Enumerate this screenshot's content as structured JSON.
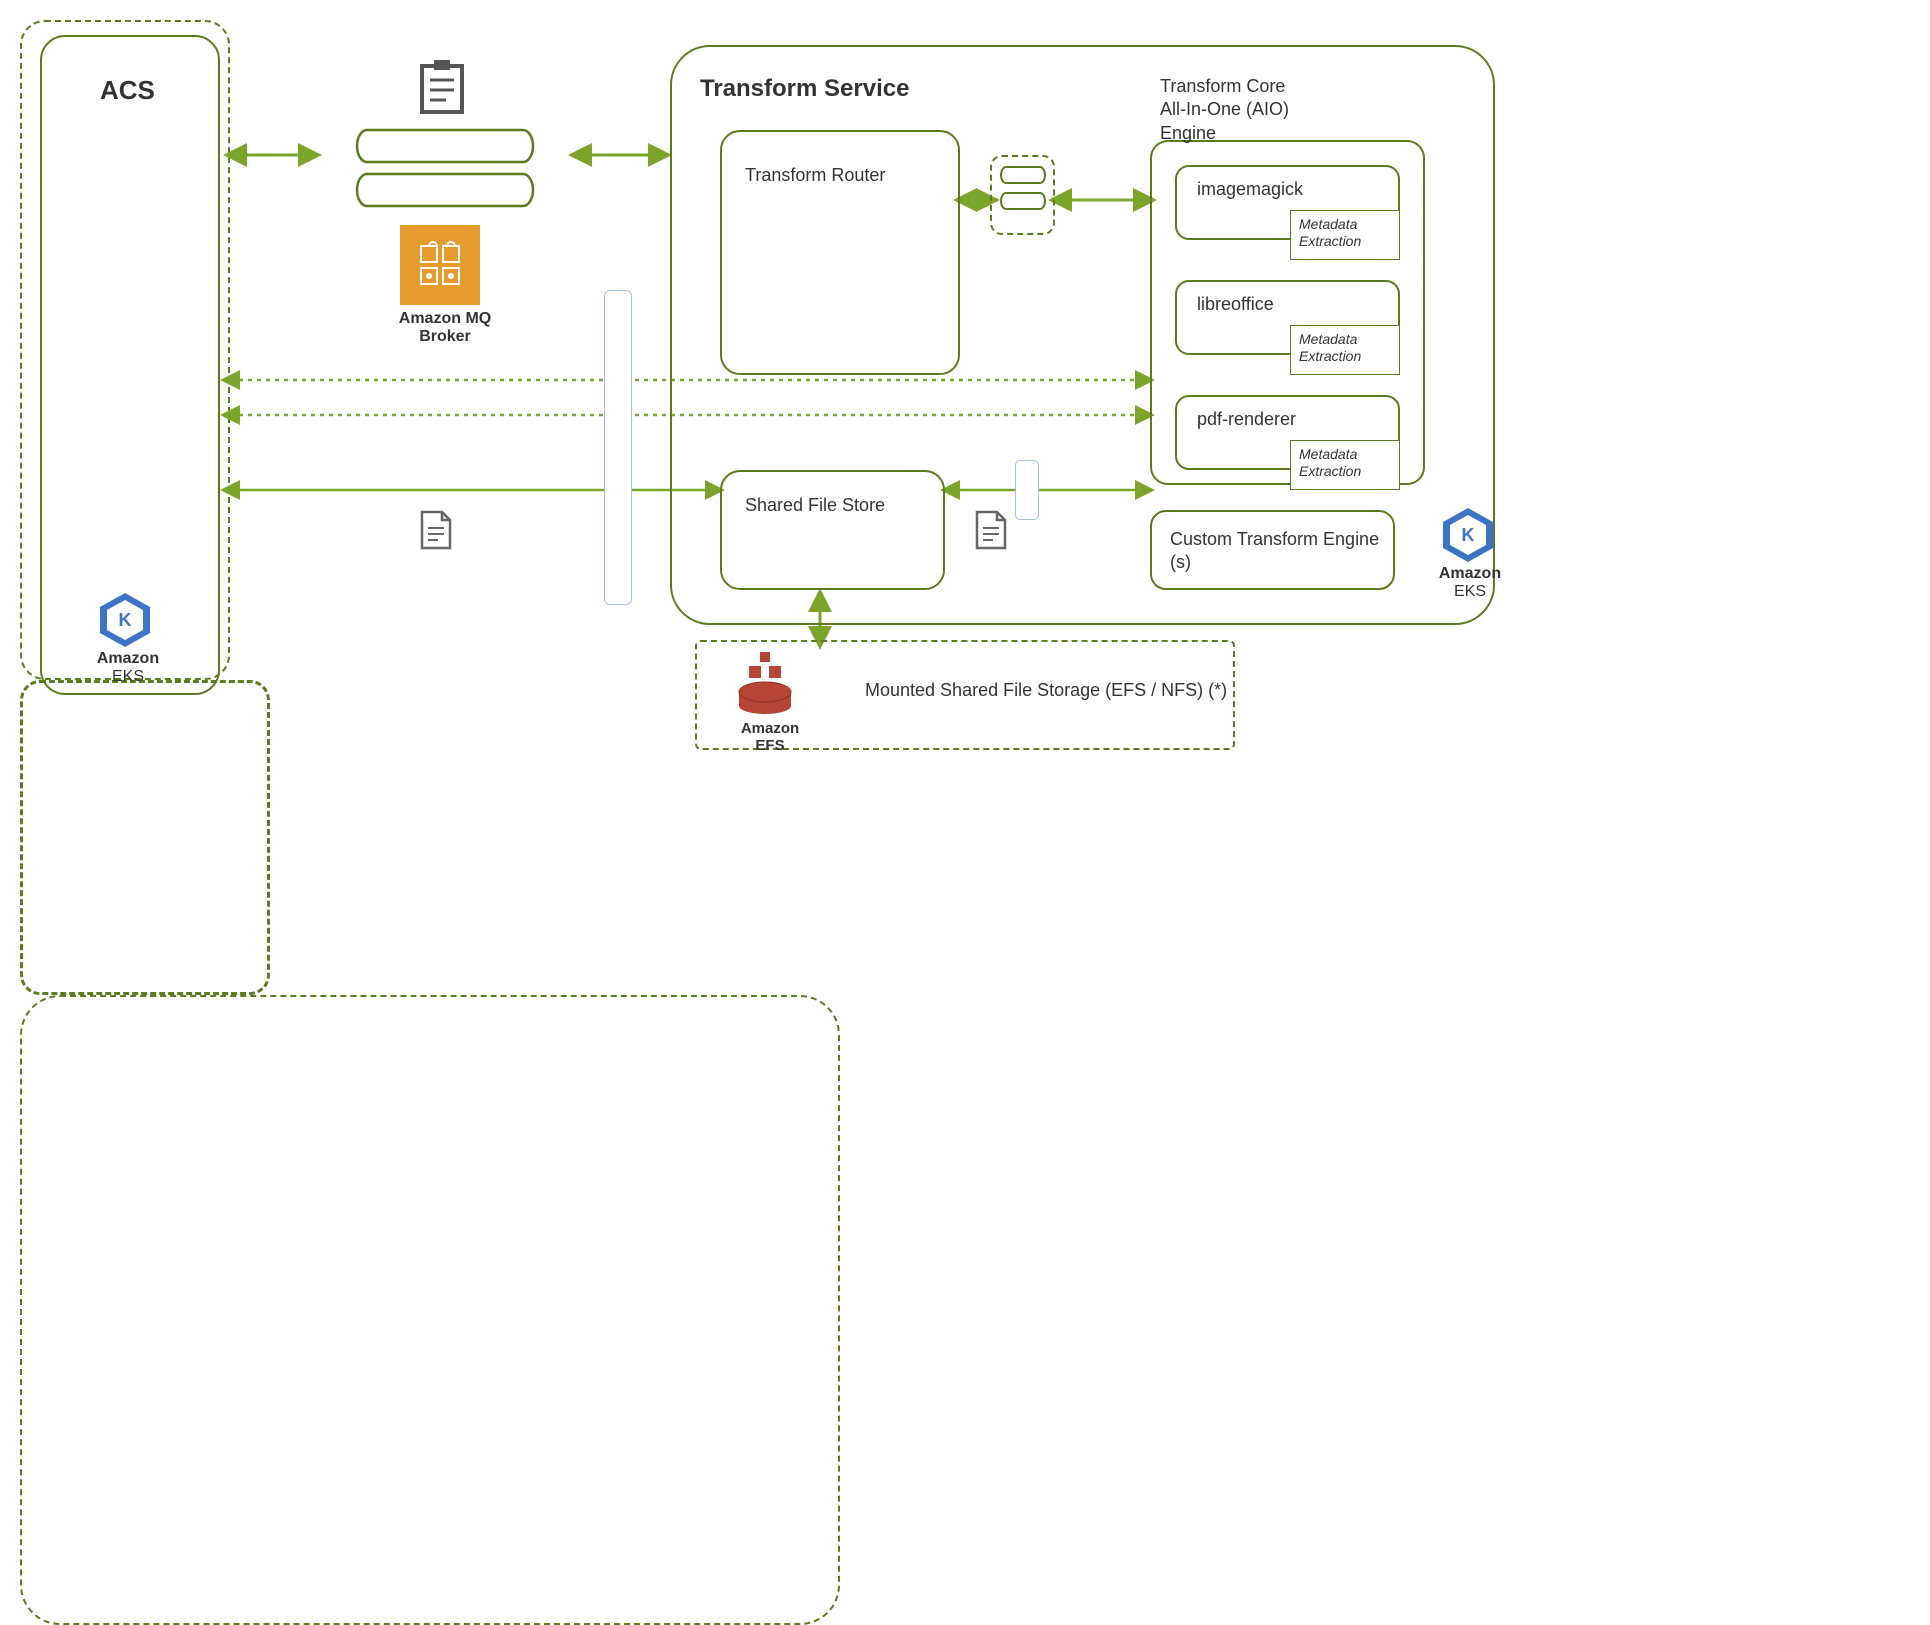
{
  "acs": {
    "title": "ACS"
  },
  "mq": {
    "label": "Amazon MQ Broker"
  },
  "transform_service": {
    "title": "Transform Service"
  },
  "router": {
    "label": "Transform Router"
  },
  "sfs": {
    "label": "Shared File Store"
  },
  "aio": {
    "title": "Transform Core\nAll-In-One (AIO)\nEngine",
    "engines": [
      {
        "name": "imagemagick",
        "meta": "Metadata Extraction"
      },
      {
        "name": "libreoffice",
        "meta": "Metadata Extraction"
      },
      {
        "name": "pdf-renderer",
        "meta": "Metadata Extraction"
      }
    ]
  },
  "custom_engine": {
    "label": "Custom Transform Engine (s)"
  },
  "efs": {
    "label": "Mounted Shared File Storage (EFS / NFS) (*)",
    "icon_label": "Amazon EFS"
  },
  "eks": {
    "label_main": "Amazon",
    "label_sub": "EKS"
  },
  "colors": {
    "green": "#5c7b1e",
    "light_green": "#7aa52a",
    "orange": "#e59b2e",
    "blue": "#3b74c5",
    "red": "#b64536"
  }
}
